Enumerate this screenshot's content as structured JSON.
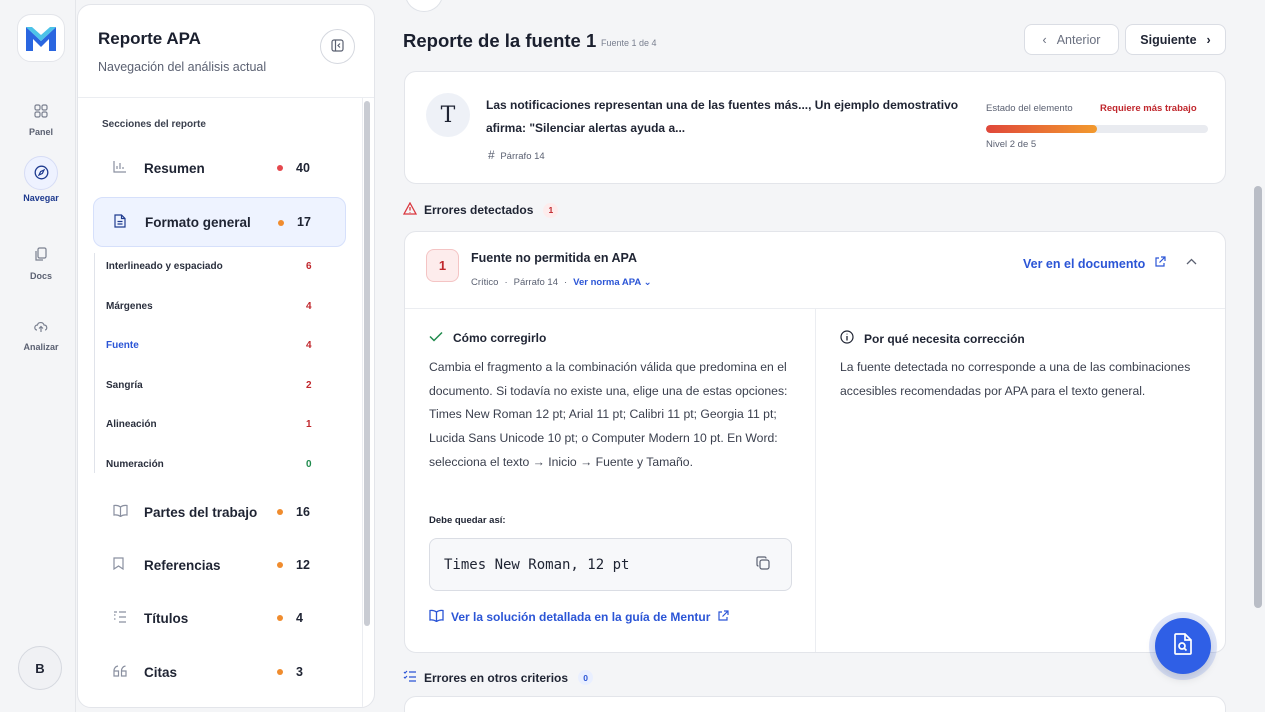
{
  "rail": {
    "items": [
      {
        "label": "Panel",
        "icon": "grid-icon"
      },
      {
        "label": "Navegar",
        "icon": "compass-icon"
      },
      {
        "label": "Docs",
        "icon": "documents-icon"
      },
      {
        "label": "Analizar",
        "icon": "upload-cloud-icon"
      }
    ],
    "avatar": "B"
  },
  "sidebar": {
    "title": "Reporte APA",
    "subtitle": "Navegación del análisis actual",
    "section_label": "Secciones del reporte",
    "items": [
      {
        "label": "Resumen",
        "count": "40",
        "dot_color": "#e5484d",
        "icon": "bar-chart-icon"
      },
      {
        "label": "Formato general",
        "count": "17",
        "dot_color": "#f08c2e",
        "icon": "document-icon"
      },
      {
        "label": "Partes del trabajo",
        "count": "16",
        "dot_color": "#f08c2e",
        "icon": "book-icon"
      },
      {
        "label": "Referencias",
        "count": "12",
        "dot_color": "#f08c2e",
        "icon": "bookmark-icon"
      },
      {
        "label": "Títulos",
        "count": "4",
        "dot_color": "#f08c2e",
        "icon": "list-indent-icon"
      },
      {
        "label": "Citas",
        "count": "3",
        "dot_color": "#f08c2e",
        "icon": "quote-icon"
      }
    ],
    "subitems": [
      {
        "label": "Interlineado y espaciado",
        "count": "6",
        "color": "#c0272d"
      },
      {
        "label": "Márgenes",
        "count": "4",
        "color": "#c0272d"
      },
      {
        "label": "Fuente",
        "count": "4",
        "color": "#c0272d"
      },
      {
        "label": "Sangría",
        "count": "2",
        "color": "#c0272d"
      },
      {
        "label": "Alineación",
        "count": "1",
        "color": "#c0272d"
      },
      {
        "label": "Numeración",
        "count": "0",
        "color": "#1f8a4c"
      }
    ]
  },
  "main": {
    "title": "Reporte de la fuente 1",
    "subtitle": "Fuente 1 de 4",
    "prev_label": "Anterior",
    "next_label": "Siguiente",
    "snippet": {
      "initial": "T",
      "text": "Las notificaciones representan una de las fuentes más..., Un ejemplo demostrativo afirma: \"Silenciar alertas ayuda a...",
      "meta": "Párrafo 14",
      "state_label": "Estado del elemento",
      "state_value": "Requiere más trabajo",
      "level_text": "Nivel 2 de 5",
      "level_fraction": 0.5
    },
    "errors_heading": "Errores detectados",
    "errors_count": "1",
    "error": {
      "number": "1",
      "title": "Fuente no permitida en APA",
      "severity": "Crítico",
      "paragraph": "Párrafo 14",
      "rule_link": "Ver norma APA",
      "view_doc": "Ver en el documento",
      "fix_heading": "Cómo corregirlo",
      "fix_text": "Cambia el fragmento a la combinación válida que predomina en el documento. Si todavía no existe una, elige una de estas opciones: Times New Roman 12 pt; Arial 11 pt; Calibri 11 pt; Georgia 11 pt; Lucida Sans Unicode 10 pt; o Computer Modern 10 pt. En Word: selecciona el texto → Inicio → Fuente y Tamaño.",
      "should_be_label": "Debe quedar así:",
      "should_be_value": "Times New Roman, 12 pt",
      "guide_link": "Ver la solución detallada en la guía de Mentur",
      "why_heading": "Por qué necesita corrección",
      "why_text": "La fuente detectada no corresponde a una de las combinaciones accesibles recomendadas por APA para el texto general."
    },
    "other_heading": "Errores en otros criterios",
    "other_count": "0"
  }
}
